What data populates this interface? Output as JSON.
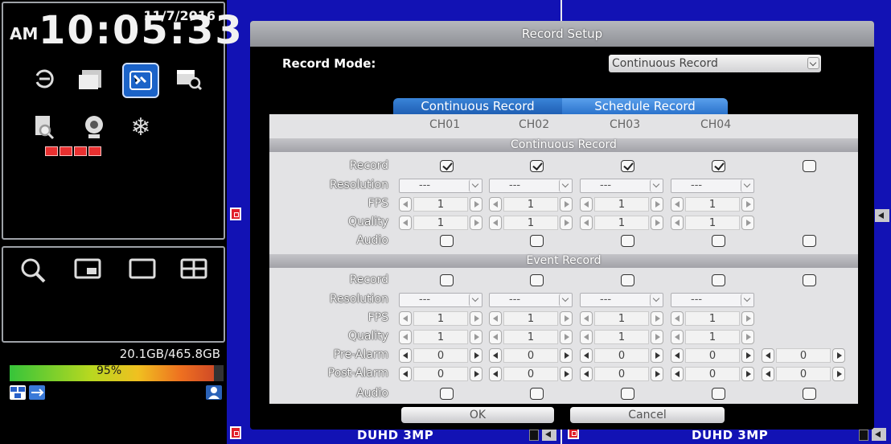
{
  "clock": {
    "date": "11/7/2016",
    "ampm": "AM",
    "time": "10:05:33"
  },
  "menu_icons": [
    "back-icon",
    "folder-icon",
    "record-setup-icon",
    "schedule-search-icon",
    "file-search-icon",
    "camera-icon",
    "freeze-icon"
  ],
  "view_icons": [
    "search-icon",
    "pip-view-icon",
    "single-view-icon",
    "quad-view-icon"
  ],
  "storage": {
    "usage_text": "20.1GB/465.8GB",
    "percent_text": "95%",
    "percent": 95
  },
  "camera_labels": [
    "DUHD 3MP",
    "DUHD 3MP"
  ],
  "dialog": {
    "title": "Record Setup",
    "record_mode_label": "Record Mode:",
    "record_mode_value": "Continuous Record",
    "tabs": [
      "Continuous Record",
      "Schedule Record"
    ],
    "channels": [
      "CH01",
      "CH02",
      "CH03",
      "CH04"
    ],
    "sections": {
      "continuous": {
        "title": "Continuous Record",
        "labels": [
          "Record",
          "Resolution",
          "FPS",
          "Quality",
          "Audio"
        ],
        "record": [
          true,
          true,
          true,
          true,
          false
        ],
        "resolution": [
          "---",
          "---",
          "---",
          "---"
        ],
        "fps": [
          "1",
          "1",
          "1",
          "1"
        ],
        "quality": [
          "1",
          "1",
          "1",
          "1"
        ],
        "audio": [
          false,
          false,
          false,
          false,
          false
        ]
      },
      "event": {
        "title": "Event Record",
        "labels": [
          "Record",
          "Resolution",
          "FPS",
          "Quality",
          "Pre-Alarm",
          "Post-Alarm",
          "Audio"
        ],
        "record": [
          false,
          false,
          false,
          false,
          false
        ],
        "resolution": [
          "---",
          "---",
          "---",
          "---"
        ],
        "fps": [
          "1",
          "1",
          "1",
          "1"
        ],
        "quality": [
          "1",
          "1",
          "1",
          "1"
        ],
        "pre_alarm": [
          "0",
          "0",
          "0",
          "0",
          "0"
        ],
        "post_alarm": [
          "0",
          "0",
          "0",
          "0",
          "0"
        ],
        "audio": [
          false,
          false,
          false,
          false,
          false
        ]
      }
    },
    "buttons": {
      "ok": "OK",
      "cancel": "Cancel"
    }
  }
}
